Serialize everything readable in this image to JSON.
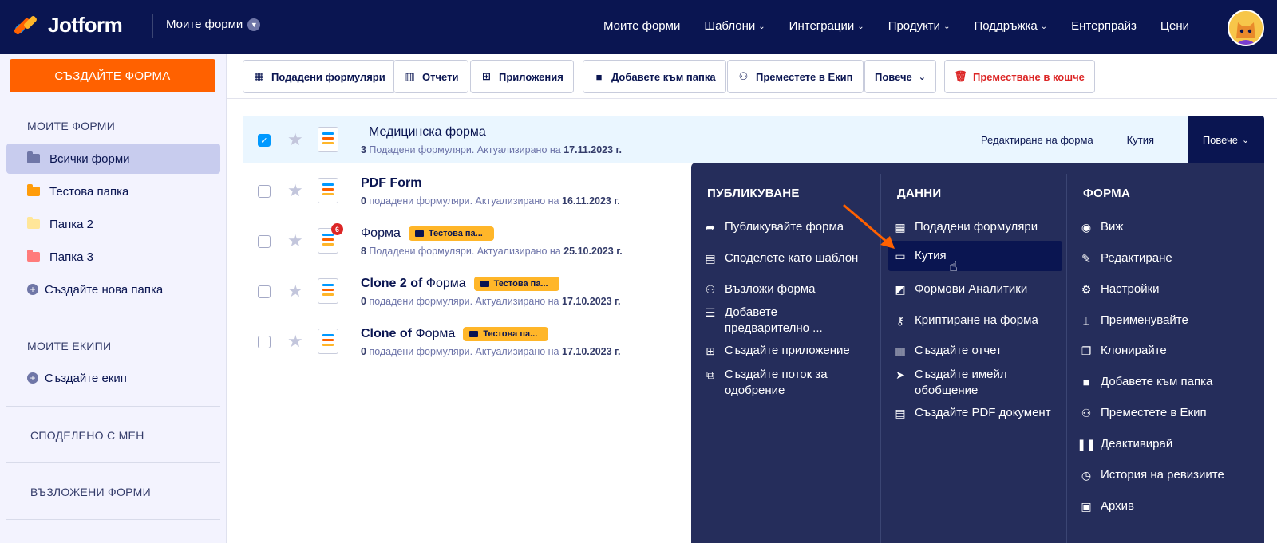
{
  "brand": {
    "name": "Jotform"
  },
  "topbar": {
    "my_forms": "Моите форми",
    "nav": [
      {
        "label": "Моите форми",
        "dropdown": false
      },
      {
        "label": "Шаблони",
        "dropdown": true
      },
      {
        "label": "Интеграции",
        "dropdown": true
      },
      {
        "label": "Продукти",
        "dropdown": true
      },
      {
        "label": "Поддръжка",
        "dropdown": true
      },
      {
        "label": "Ентерпрайз",
        "dropdown": false
      },
      {
        "label": "Цени",
        "dropdown": false
      }
    ]
  },
  "sidebar": {
    "create_button": "СЪЗДАЙТЕ ФОРМА",
    "my_forms_heading": "МОИТЕ ФОРМИ",
    "folders": [
      {
        "label": "Всички форми",
        "color": "#6f76a7",
        "active": true
      },
      {
        "label": "Тестова папка",
        "color": "#ff9c0a",
        "active": false
      },
      {
        "label": "Папка 2",
        "color": "#ffe699",
        "active": false
      },
      {
        "label": "Папка 3",
        "color": "#ff7b7b",
        "active": false
      }
    ],
    "create_folder": "Създайте нова папка",
    "teams_heading": "МОИТЕ ЕКИПИ",
    "create_team": "Създайте екип",
    "shared_heading": "СПОДЕЛЕНО С МЕН",
    "assigned_heading": "ВЪЗЛОЖЕНИ ФОРМИ"
  },
  "toolbar": {
    "submissions": "Подадени формуляри",
    "reports": "Отчети",
    "apps": "Приложения",
    "add_to_folder": "Добавете към папка",
    "move_to_team": "Преместете в Екип",
    "more": "Повече",
    "trash": "Преместване в кошче"
  },
  "forms": [
    {
      "title_bold": "",
      "title": "Медицинска форма",
      "count": "3",
      "sub": " Подадени формуляри. Актуализирано на ",
      "date": "17.11.2023 г.",
      "tag": "",
      "selected": true,
      "badge": ""
    },
    {
      "title_bold": "PDF Form",
      "title": "",
      "count": "0",
      "sub": " подадени формуляри. Актуализирано на ",
      "date": "16.11.2023 г.",
      "tag": "",
      "selected": false,
      "badge": ""
    },
    {
      "title_bold": "",
      "title": "Форма",
      "count": "8",
      "sub": " Подадени формуляри. Актуализирано на ",
      "date": "25.10.2023 г.",
      "tag": "Тестова па...",
      "selected": false,
      "badge": "6"
    },
    {
      "title_bold": "Clone 2 of",
      "title": " Форма",
      "count": "0",
      "sub": " подадени формуляри. Актуализирано на ",
      "date": "17.10.2023 г.",
      "tag": "Тестова па...",
      "selected": false,
      "badge": ""
    },
    {
      "title_bold": "Clone of",
      "title": " Форма",
      "count": "0",
      "sub": " подадени формуляри. Актуализирано на ",
      "date": "17.10.2023 г.",
      "tag": "Тестова па...",
      "selected": false,
      "badge": ""
    }
  ],
  "row_actions": {
    "edit": "Редактиране на форма",
    "inbox": "Кутия",
    "more": "Повече"
  },
  "menu": {
    "publish": {
      "heading": "ПУБЛИКУВАНЕ",
      "items": [
        {
          "icon": "share-arrow-icon",
          "label": "Публикувайте форма"
        },
        {
          "icon": "template-icon",
          "label": "Споделете като шаблон"
        },
        {
          "icon": "assign-users-icon",
          "label": "Възложи форма"
        },
        {
          "icon": "prefill-icon",
          "label": "Добавете предварително ..."
        },
        {
          "icon": "app-icon",
          "label": "Създайте приложение"
        },
        {
          "icon": "approval-flow-icon",
          "label": "Създайте поток за одобрение"
        }
      ]
    },
    "data": {
      "heading": "ДАННИ",
      "items": [
        {
          "icon": "table-icon",
          "label": "Подадени формуляри"
        },
        {
          "icon": "inbox-icon",
          "label": "Кутия"
        },
        {
          "icon": "analytics-icon",
          "label": "Формови Аналитики"
        },
        {
          "icon": "key-icon",
          "label": "Криптиране на форма"
        },
        {
          "icon": "report-icon",
          "label": "Създайте отчет"
        },
        {
          "icon": "send-icon",
          "label": "Създайте имейл обобщение"
        },
        {
          "icon": "pdf-icon",
          "label": "Създайте PDF документ"
        }
      ]
    },
    "form": {
      "heading": "ФОРМА",
      "items": [
        {
          "icon": "eye-icon",
          "label": "Виж"
        },
        {
          "icon": "edit-icon",
          "label": "Редактиране"
        },
        {
          "icon": "gear-icon",
          "label": "Настройки"
        },
        {
          "icon": "rename-icon",
          "label": "Преименувайте"
        },
        {
          "icon": "clone-icon",
          "label": "Клонирайте"
        },
        {
          "icon": "folder-plus-icon",
          "label": "Добавете към папка"
        },
        {
          "icon": "team-icon",
          "label": "Преместете в Екип"
        },
        {
          "icon": "pause-icon",
          "label": "Деактивирай"
        },
        {
          "icon": "history-icon",
          "label": "История на ревизиите"
        },
        {
          "icon": "archive-icon",
          "label": "Архив"
        }
      ]
    }
  },
  "colors": {
    "navy": "#0a1551",
    "panel": "#252d5b",
    "orange": "#ff6100",
    "accent_blue": "#0099ff",
    "tag": "#ffb629"
  }
}
